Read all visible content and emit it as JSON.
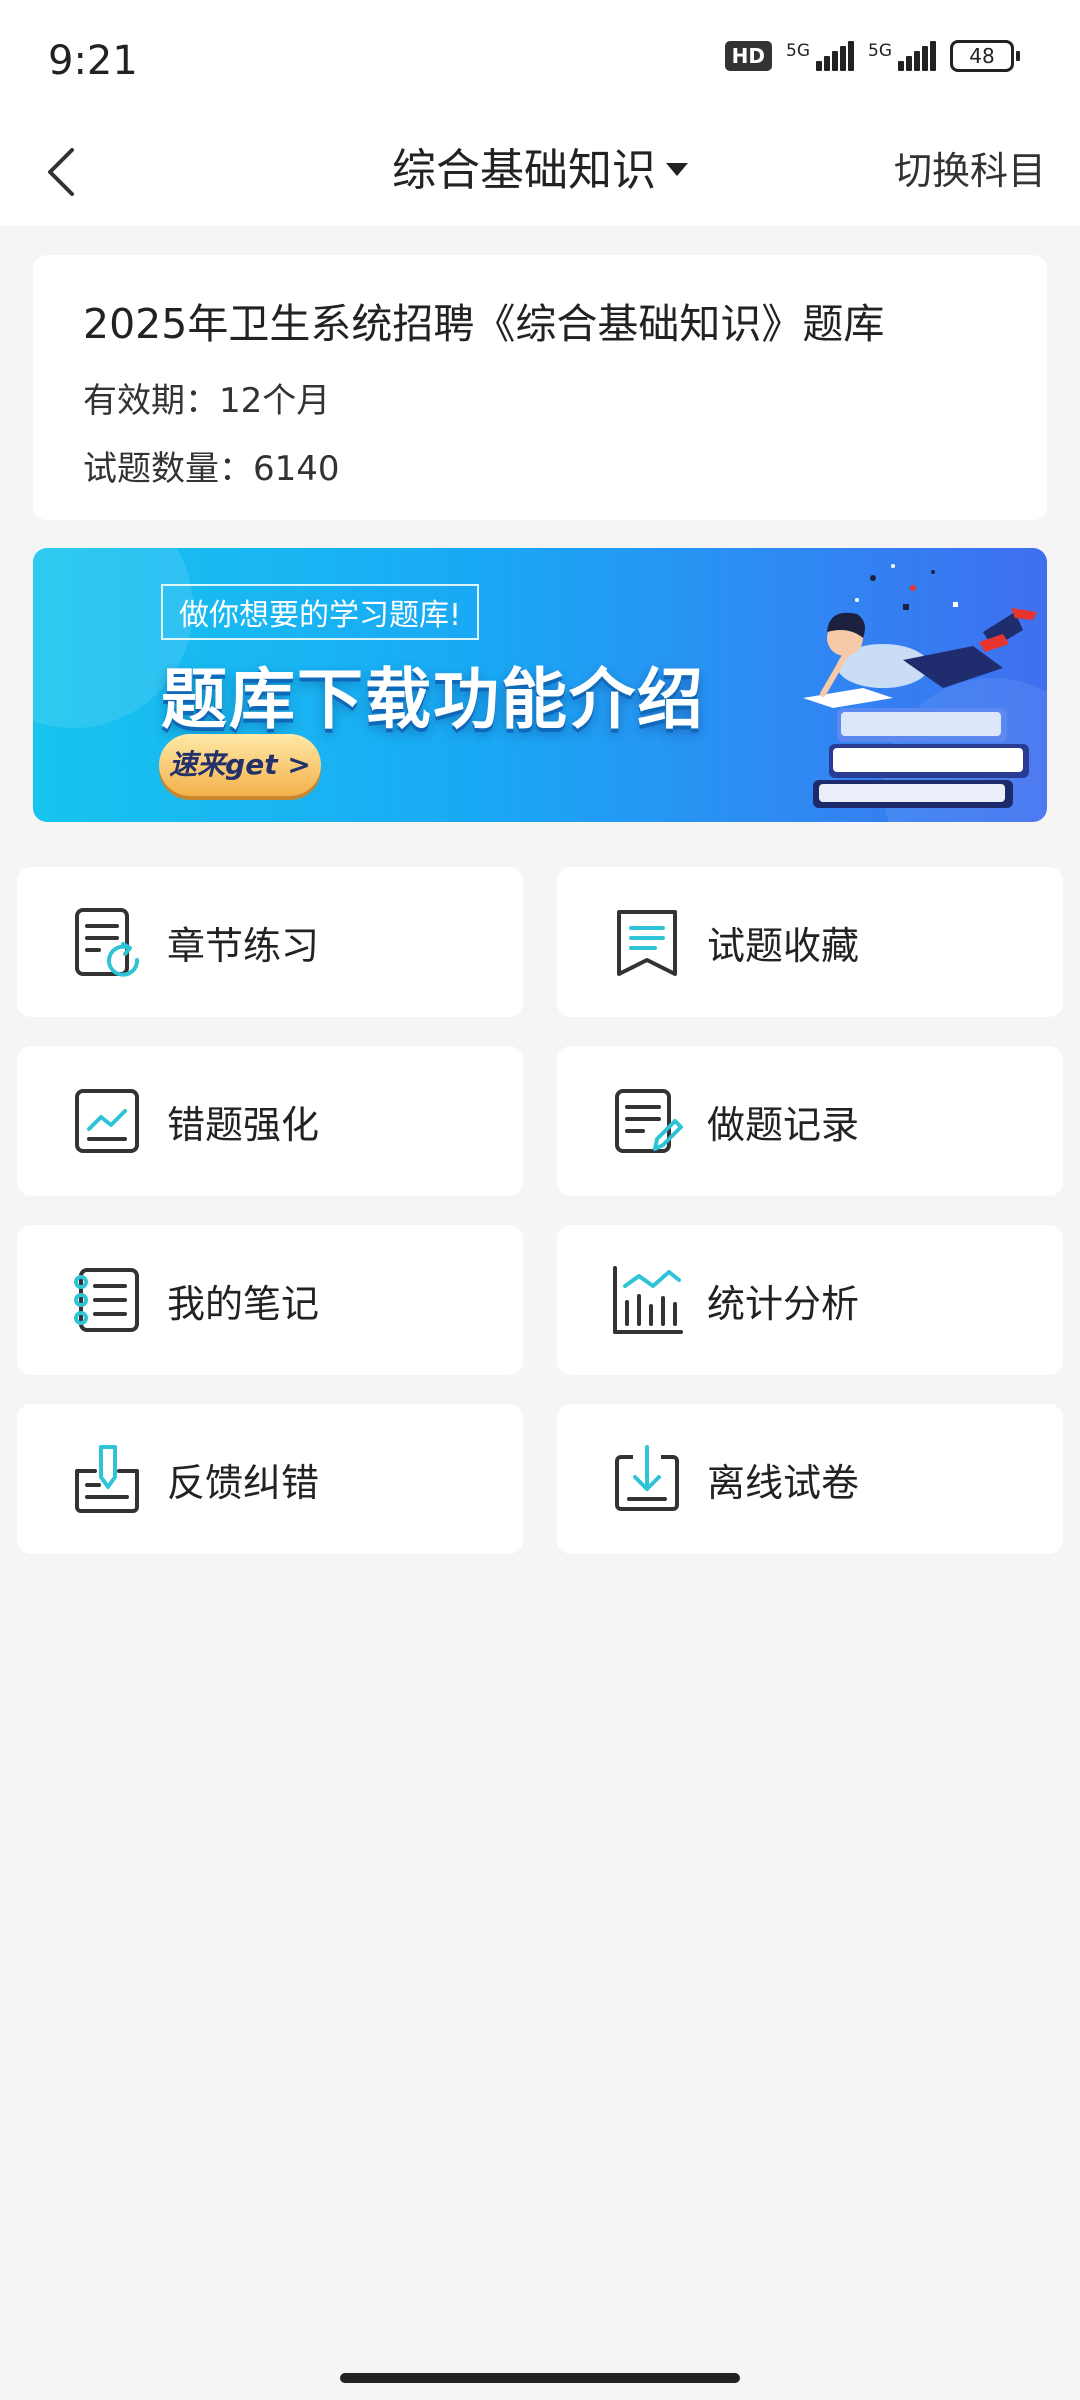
{
  "status_bar": {
    "time": "9:21",
    "hd_label": "HD",
    "network1": "5G",
    "network2": "5G",
    "battery": "48"
  },
  "nav": {
    "title": "综合基础知识",
    "switch_label": "切换科目"
  },
  "info": {
    "title": "2025年卫生系统招聘《综合基础知识》题库",
    "validity": "有效期：12个月",
    "count": "试题数量：6140"
  },
  "banner": {
    "tag": "做你想要的学习题库!",
    "heading": "题库下载功能介绍",
    "button": "速来get >"
  },
  "menu": [
    {
      "label": "章节练习",
      "icon": "chapter-practice-icon"
    },
    {
      "label": "试题收藏",
      "icon": "bookmark-icon"
    },
    {
      "label": "错题强化",
      "icon": "wrong-question-icon"
    },
    {
      "label": "做题记录",
      "icon": "record-edit-icon"
    },
    {
      "label": "我的笔记",
      "icon": "notebook-icon"
    },
    {
      "label": "统计分析",
      "icon": "bar-chart-icon"
    },
    {
      "label": "反馈纠错",
      "icon": "feedback-icon"
    },
    {
      "label": "离线试卷",
      "icon": "download-icon"
    }
  ],
  "colors": {
    "accent": "#2ec4d6",
    "icon_dark": "#333333",
    "page_bg": "#f5f5f5"
  }
}
